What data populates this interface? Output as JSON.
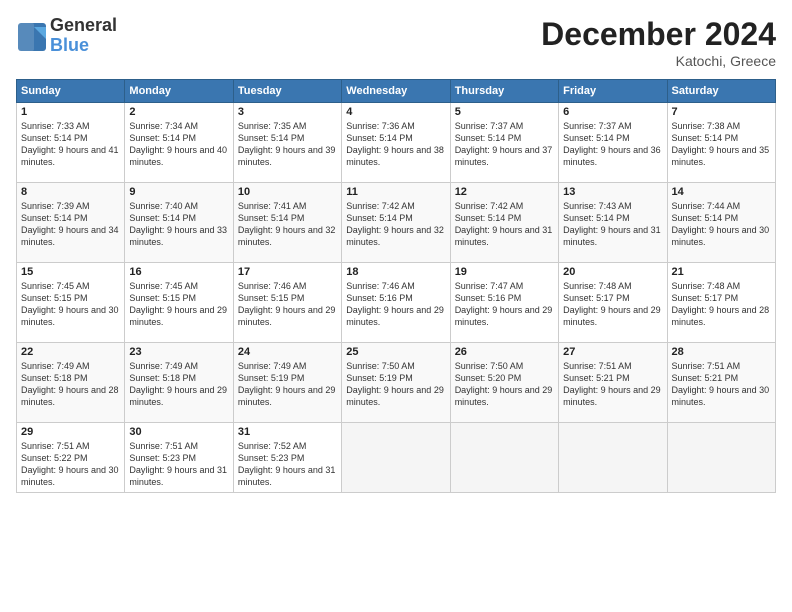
{
  "logo": {
    "line1": "General",
    "line2": "Blue"
  },
  "header": {
    "month": "December 2024",
    "location": "Katochi, Greece"
  },
  "weekdays": [
    "Sunday",
    "Monday",
    "Tuesday",
    "Wednesday",
    "Thursday",
    "Friday",
    "Saturday"
  ],
  "days": [
    {
      "num": "",
      "info": ""
    },
    {
      "num": "",
      "info": ""
    },
    {
      "num": "",
      "info": ""
    },
    {
      "num": "",
      "info": ""
    },
    {
      "num": "",
      "info": ""
    },
    {
      "num": "",
      "info": ""
    },
    {
      "num": "1",
      "sunrise": "7:33 AM",
      "sunset": "5:14 PM",
      "daylight": "9 hours and 41 minutes."
    },
    {
      "num": "2",
      "sunrise": "7:34 AM",
      "sunset": "5:14 PM",
      "daylight": "9 hours and 40 minutes."
    },
    {
      "num": "3",
      "sunrise": "7:35 AM",
      "sunset": "5:14 PM",
      "daylight": "9 hours and 39 minutes."
    },
    {
      "num": "4",
      "sunrise": "7:36 AM",
      "sunset": "5:14 PM",
      "daylight": "9 hours and 38 minutes."
    },
    {
      "num": "5",
      "sunrise": "7:37 AM",
      "sunset": "5:14 PM",
      "daylight": "9 hours and 37 minutes."
    },
    {
      "num": "6",
      "sunrise": "7:37 AM",
      "sunset": "5:14 PM",
      "daylight": "9 hours and 36 minutes."
    },
    {
      "num": "7",
      "sunrise": "7:38 AM",
      "sunset": "5:14 PM",
      "daylight": "9 hours and 35 minutes."
    },
    {
      "num": "8",
      "sunrise": "7:39 AM",
      "sunset": "5:14 PM",
      "daylight": "9 hours and 34 minutes."
    },
    {
      "num": "9",
      "sunrise": "7:40 AM",
      "sunset": "5:14 PM",
      "daylight": "9 hours and 33 minutes."
    },
    {
      "num": "10",
      "sunrise": "7:41 AM",
      "sunset": "5:14 PM",
      "daylight": "9 hours and 32 minutes."
    },
    {
      "num": "11",
      "sunrise": "7:42 AM",
      "sunset": "5:14 PM",
      "daylight": "9 hours and 32 minutes."
    },
    {
      "num": "12",
      "sunrise": "7:42 AM",
      "sunset": "5:14 PM",
      "daylight": "9 hours and 31 minutes."
    },
    {
      "num": "13",
      "sunrise": "7:43 AM",
      "sunset": "5:14 PM",
      "daylight": "9 hours and 31 minutes."
    },
    {
      "num": "14",
      "sunrise": "7:44 AM",
      "sunset": "5:14 PM",
      "daylight": "9 hours and 30 minutes."
    },
    {
      "num": "15",
      "sunrise": "7:45 AM",
      "sunset": "5:15 PM",
      "daylight": "9 hours and 30 minutes."
    },
    {
      "num": "16",
      "sunrise": "7:45 AM",
      "sunset": "5:15 PM",
      "daylight": "9 hours and 29 minutes."
    },
    {
      "num": "17",
      "sunrise": "7:46 AM",
      "sunset": "5:15 PM",
      "daylight": "9 hours and 29 minutes."
    },
    {
      "num": "18",
      "sunrise": "7:46 AM",
      "sunset": "5:16 PM",
      "daylight": "9 hours and 29 minutes."
    },
    {
      "num": "19",
      "sunrise": "7:47 AM",
      "sunset": "5:16 PM",
      "daylight": "9 hours and 29 minutes."
    },
    {
      "num": "20",
      "sunrise": "7:48 AM",
      "sunset": "5:17 PM",
      "daylight": "9 hours and 29 minutes."
    },
    {
      "num": "21",
      "sunrise": "7:48 AM",
      "sunset": "5:17 PM",
      "daylight": "9 hours and 28 minutes."
    },
    {
      "num": "22",
      "sunrise": "7:49 AM",
      "sunset": "5:18 PM",
      "daylight": "9 hours and 28 minutes."
    },
    {
      "num": "23",
      "sunrise": "7:49 AM",
      "sunset": "5:18 PM",
      "daylight": "9 hours and 29 minutes."
    },
    {
      "num": "24",
      "sunrise": "7:49 AM",
      "sunset": "5:19 PM",
      "daylight": "9 hours and 29 minutes."
    },
    {
      "num": "25",
      "sunrise": "7:50 AM",
      "sunset": "5:19 PM",
      "daylight": "9 hours and 29 minutes."
    },
    {
      "num": "26",
      "sunrise": "7:50 AM",
      "sunset": "5:20 PM",
      "daylight": "9 hours and 29 minutes."
    },
    {
      "num": "27",
      "sunrise": "7:51 AM",
      "sunset": "5:21 PM",
      "daylight": "9 hours and 29 minutes."
    },
    {
      "num": "28",
      "sunrise": "7:51 AM",
      "sunset": "5:21 PM",
      "daylight": "9 hours and 30 minutes."
    },
    {
      "num": "29",
      "sunrise": "7:51 AM",
      "sunset": "5:22 PM",
      "daylight": "9 hours and 30 minutes."
    },
    {
      "num": "30",
      "sunrise": "7:51 AM",
      "sunset": "5:23 PM",
      "daylight": "9 hours and 31 minutes."
    },
    {
      "num": "31",
      "sunrise": "7:52 AM",
      "sunset": "5:23 PM",
      "daylight": "9 hours and 31 minutes."
    }
  ],
  "labels": {
    "sunrise": "Sunrise:",
    "sunset": "Sunset:",
    "daylight": "Daylight:"
  }
}
